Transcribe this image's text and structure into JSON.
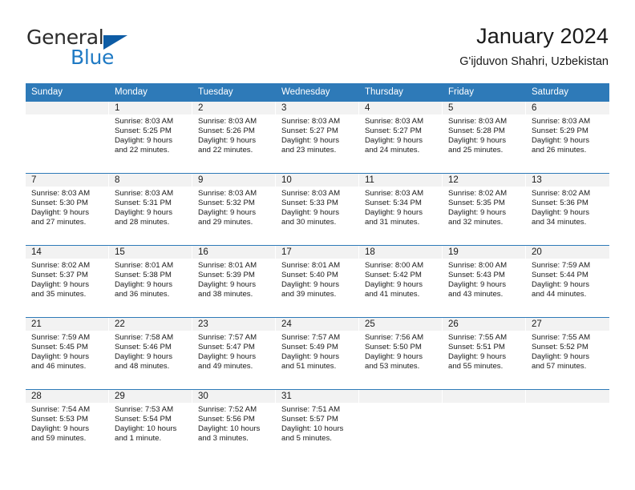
{
  "brand": {
    "name_part1": "General",
    "name_part2": "Blue",
    "flag_icon": "triangle-flag-icon"
  },
  "header": {
    "title": "January 2024",
    "subtitle": "G'ijduvon Shahri, Uzbekistan"
  },
  "colors": {
    "header_blue": "#2e7ab8",
    "brand_blue": "#1f7ac4",
    "flag_blue": "#0d5ca5",
    "day_band_gray": "#f2f2f2"
  },
  "calendar": {
    "weekdays": [
      "Sunday",
      "Monday",
      "Tuesday",
      "Wednesday",
      "Thursday",
      "Friday",
      "Saturday"
    ],
    "weeks": [
      [
        {
          "day": "",
          "info": ""
        },
        {
          "day": "1",
          "info": "Sunrise: 8:03 AM\nSunset: 5:25 PM\nDaylight: 9 hours\nand 22 minutes."
        },
        {
          "day": "2",
          "info": "Sunrise: 8:03 AM\nSunset: 5:26 PM\nDaylight: 9 hours\nand 22 minutes."
        },
        {
          "day": "3",
          "info": "Sunrise: 8:03 AM\nSunset: 5:27 PM\nDaylight: 9 hours\nand 23 minutes."
        },
        {
          "day": "4",
          "info": "Sunrise: 8:03 AM\nSunset: 5:27 PM\nDaylight: 9 hours\nand 24 minutes."
        },
        {
          "day": "5",
          "info": "Sunrise: 8:03 AM\nSunset: 5:28 PM\nDaylight: 9 hours\nand 25 minutes."
        },
        {
          "day": "6",
          "info": "Sunrise: 8:03 AM\nSunset: 5:29 PM\nDaylight: 9 hours\nand 26 minutes."
        }
      ],
      [
        {
          "day": "7",
          "info": "Sunrise: 8:03 AM\nSunset: 5:30 PM\nDaylight: 9 hours\nand 27 minutes."
        },
        {
          "day": "8",
          "info": "Sunrise: 8:03 AM\nSunset: 5:31 PM\nDaylight: 9 hours\nand 28 minutes."
        },
        {
          "day": "9",
          "info": "Sunrise: 8:03 AM\nSunset: 5:32 PM\nDaylight: 9 hours\nand 29 minutes."
        },
        {
          "day": "10",
          "info": "Sunrise: 8:03 AM\nSunset: 5:33 PM\nDaylight: 9 hours\nand 30 minutes."
        },
        {
          "day": "11",
          "info": "Sunrise: 8:03 AM\nSunset: 5:34 PM\nDaylight: 9 hours\nand 31 minutes."
        },
        {
          "day": "12",
          "info": "Sunrise: 8:02 AM\nSunset: 5:35 PM\nDaylight: 9 hours\nand 32 minutes."
        },
        {
          "day": "13",
          "info": "Sunrise: 8:02 AM\nSunset: 5:36 PM\nDaylight: 9 hours\nand 34 minutes."
        }
      ],
      [
        {
          "day": "14",
          "info": "Sunrise: 8:02 AM\nSunset: 5:37 PM\nDaylight: 9 hours\nand 35 minutes."
        },
        {
          "day": "15",
          "info": "Sunrise: 8:01 AM\nSunset: 5:38 PM\nDaylight: 9 hours\nand 36 minutes."
        },
        {
          "day": "16",
          "info": "Sunrise: 8:01 AM\nSunset: 5:39 PM\nDaylight: 9 hours\nand 38 minutes."
        },
        {
          "day": "17",
          "info": "Sunrise: 8:01 AM\nSunset: 5:40 PM\nDaylight: 9 hours\nand 39 minutes."
        },
        {
          "day": "18",
          "info": "Sunrise: 8:00 AM\nSunset: 5:42 PM\nDaylight: 9 hours\nand 41 minutes."
        },
        {
          "day": "19",
          "info": "Sunrise: 8:00 AM\nSunset: 5:43 PM\nDaylight: 9 hours\nand 43 minutes."
        },
        {
          "day": "20",
          "info": "Sunrise: 7:59 AM\nSunset: 5:44 PM\nDaylight: 9 hours\nand 44 minutes."
        }
      ],
      [
        {
          "day": "21",
          "info": "Sunrise: 7:59 AM\nSunset: 5:45 PM\nDaylight: 9 hours\nand 46 minutes."
        },
        {
          "day": "22",
          "info": "Sunrise: 7:58 AM\nSunset: 5:46 PM\nDaylight: 9 hours\nand 48 minutes."
        },
        {
          "day": "23",
          "info": "Sunrise: 7:57 AM\nSunset: 5:47 PM\nDaylight: 9 hours\nand 49 minutes."
        },
        {
          "day": "24",
          "info": "Sunrise: 7:57 AM\nSunset: 5:49 PM\nDaylight: 9 hours\nand 51 minutes."
        },
        {
          "day": "25",
          "info": "Sunrise: 7:56 AM\nSunset: 5:50 PM\nDaylight: 9 hours\nand 53 minutes."
        },
        {
          "day": "26",
          "info": "Sunrise: 7:55 AM\nSunset: 5:51 PM\nDaylight: 9 hours\nand 55 minutes."
        },
        {
          "day": "27",
          "info": "Sunrise: 7:55 AM\nSunset: 5:52 PM\nDaylight: 9 hours\nand 57 minutes."
        }
      ],
      [
        {
          "day": "28",
          "info": "Sunrise: 7:54 AM\nSunset: 5:53 PM\nDaylight: 9 hours\nand 59 minutes."
        },
        {
          "day": "29",
          "info": "Sunrise: 7:53 AM\nSunset: 5:54 PM\nDaylight: 10 hours\nand 1 minute."
        },
        {
          "day": "30",
          "info": "Sunrise: 7:52 AM\nSunset: 5:56 PM\nDaylight: 10 hours\nand 3 minutes."
        },
        {
          "day": "31",
          "info": "Sunrise: 7:51 AM\nSunset: 5:57 PM\nDaylight: 10 hours\nand 5 minutes."
        },
        {
          "day": "",
          "info": ""
        },
        {
          "day": "",
          "info": ""
        },
        {
          "day": "",
          "info": ""
        }
      ]
    ]
  }
}
